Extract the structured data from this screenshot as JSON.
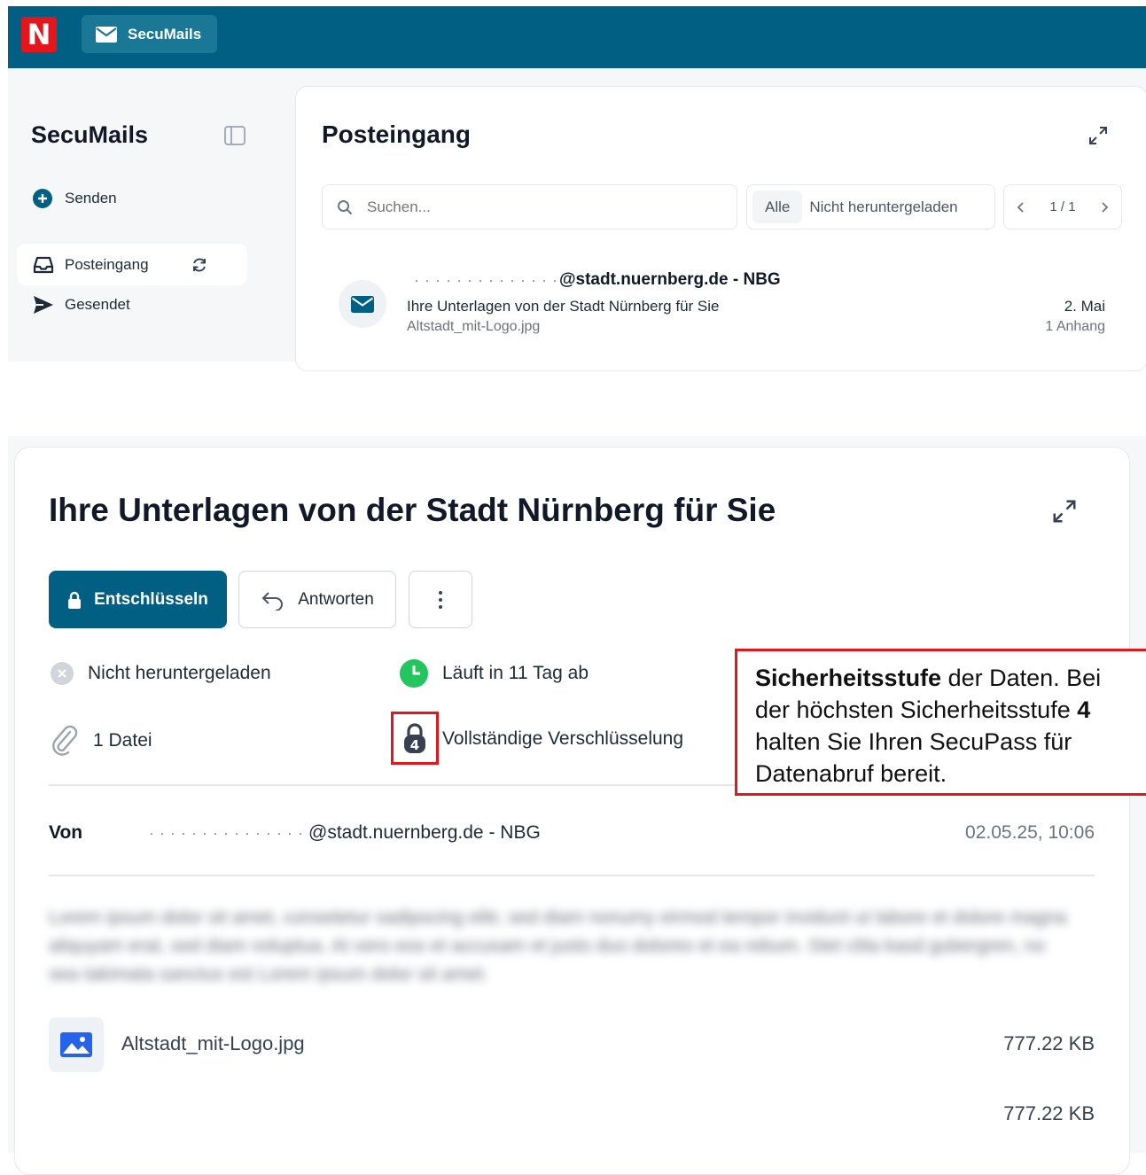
{
  "app": {
    "logo_letter": "N",
    "app_button_label": "SecuMails",
    "accent_color": "#005f82",
    "brand_red": "#e3161b"
  },
  "sidebar": {
    "title": "SecuMails",
    "items": [
      {
        "label": "Senden",
        "icon": "plus-circle-icon"
      },
      {
        "label": "Posteingang",
        "icon": "inbox-icon",
        "active": true
      },
      {
        "label": "Gesendet",
        "icon": "send-icon"
      }
    ]
  },
  "inbox": {
    "title": "Posteingang",
    "search_placeholder": "Suchen...",
    "filters": [
      "Alle",
      "Nicht heruntergeladen"
    ],
    "pager": "1 / 1",
    "message": {
      "from": "@stadt.nuernberg.de - NBG",
      "subject": "Ihre Unterlagen von der Stadt Nürnberg für Sie",
      "attachment": "Altstadt_mit-Logo.jpg",
      "date": "2. Mai",
      "attachment_count": "1 Anhang"
    }
  },
  "mail": {
    "title": "Ihre Unterlagen von der Stadt Nürnberg für Sie",
    "decrypt_label": "Entschlüsseln",
    "reply_label": "Antworten",
    "status_download": "Nicht heruntergeladen",
    "status_expiry": "Läuft in 11 Tag ab",
    "file_count": "1 Datei",
    "encryption": "Vollständige Verschlüsselung",
    "security_level": "4",
    "from_label": "Von",
    "from_value": "@stadt.nuernberg.de - NBG",
    "datetime": "02.05.25, 10:06",
    "body": "Lorem ipsum dolor sit amet, consetetur sadipscing elitr, sed diam nonumy eirmod tempor invidunt ut labore et dolore magna aliquyam erat, sed diam voluptua. At vero eos et accusam et justo duo dolores et ea rebum. Stet clita kasd gubergren, no sea takimata sanctus est Lorem ipsum dolor sit amet.",
    "attachment_name": "Altstadt_mit-Logo.jpg",
    "attachment_size": "777.22 KB",
    "attachment_size_2": "777.22 KB"
  },
  "callout": {
    "bold_1": "Sicherheitsstufe",
    "text_1": " der Daten. Bei der höchsten Sicherheitsstufe ",
    "bold_2": "4",
    "text_2": " halten Sie Ihren SecuPass für Datenabruf bereit."
  }
}
